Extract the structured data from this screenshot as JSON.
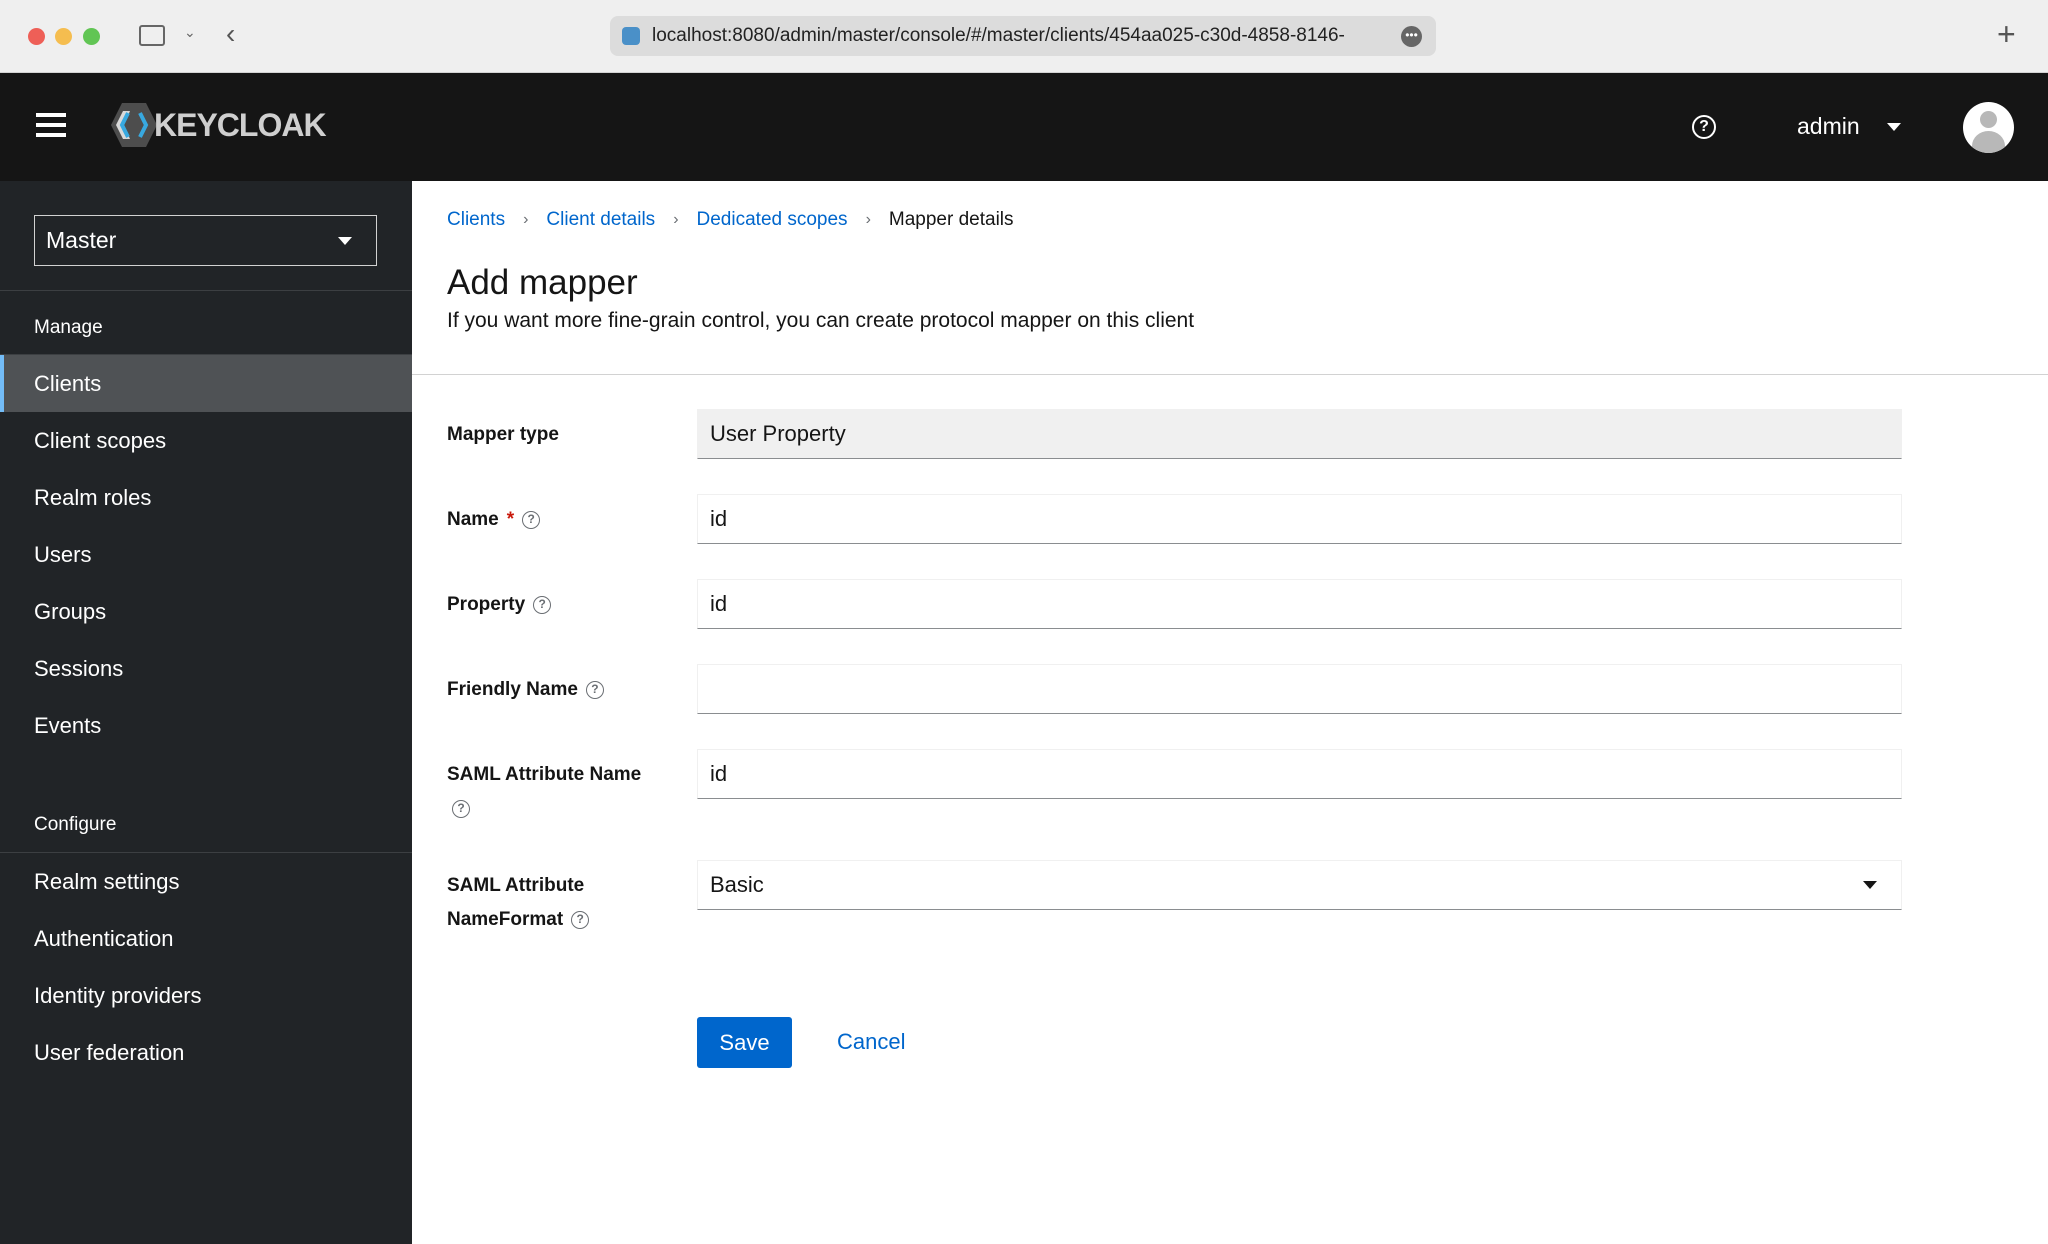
{
  "browser": {
    "url": "localhost:8080/admin/master/console/#/master/clients/454aa025-c30d-4858-8146-"
  },
  "header": {
    "logo": "KEYCLOAK",
    "user": "admin"
  },
  "sidebar": {
    "realm": "Master",
    "manage_heading": "Manage",
    "manage_items": [
      "Clients",
      "Client scopes",
      "Realm roles",
      "Users",
      "Groups",
      "Sessions",
      "Events"
    ],
    "active": "Clients",
    "configure_heading": "Configure",
    "configure_items": [
      "Realm settings",
      "Authentication",
      "Identity providers",
      "User federation"
    ]
  },
  "breadcrumb": [
    "Clients",
    "Client details",
    "Dedicated scopes",
    "Mapper details"
  ],
  "page": {
    "title": "Add mapper",
    "subtitle": "If you want more fine-grain control, you can create protocol mapper on this client"
  },
  "form": {
    "mapper_type": {
      "label": "Mapper type",
      "value": "User Property"
    },
    "name": {
      "label": "Name",
      "required": "*",
      "value": "id"
    },
    "property": {
      "label": "Property",
      "value": "id"
    },
    "friendly_name": {
      "label": "Friendly Name",
      "value": ""
    },
    "saml_attribute_name": {
      "label": "SAML Attribute Name",
      "value": "id"
    },
    "saml_nameformat": {
      "label_line1": "SAML Attribute",
      "label_line2": "NameFormat",
      "value": "Basic"
    },
    "save": "Save",
    "cancel": "Cancel"
  },
  "colors": {
    "link": "#0066cc",
    "primary": "#0066cc",
    "header_bg": "#151515",
    "sidebar_bg": "#212427",
    "active_indicator": "#73bcf7"
  }
}
